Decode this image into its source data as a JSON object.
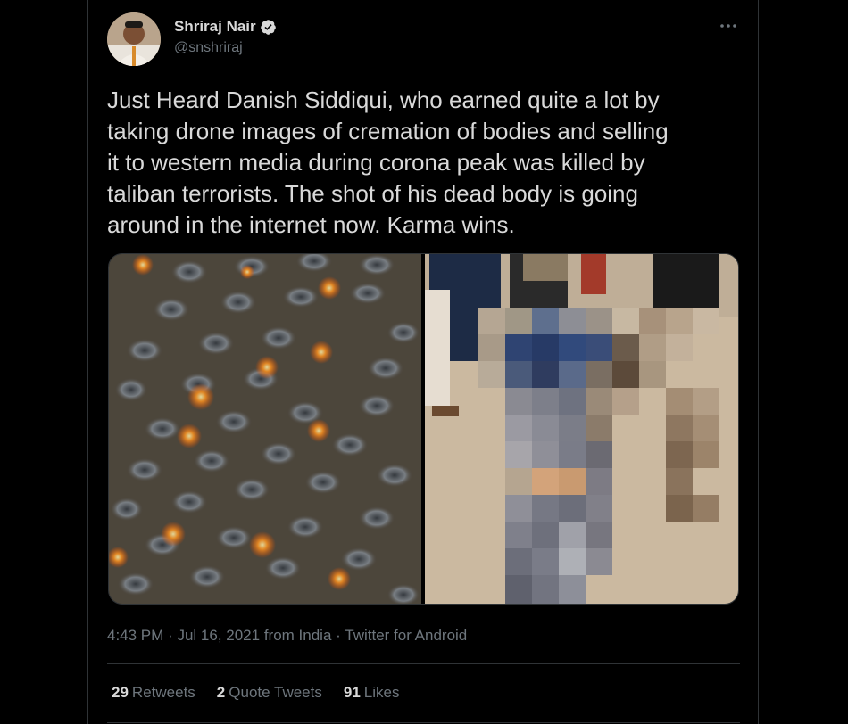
{
  "author": {
    "display_name": "Shriraj Nair",
    "handle": "@snshriraj",
    "verified": true
  },
  "tweet": {
    "text": "Just Heard Danish Siddiqui, who earned quite a lot by\ntaking drone images of cremation of bodies and selling\nit to western media during corona peak was killed by\ntaliban terrorists. The shot of his dead body is going\naround in the internet now. Karma wins."
  },
  "meta": {
    "time": "4:43 PM",
    "sep1": "·",
    "date": "Jul 16, 2021",
    "location": "from India",
    "sep2": "·",
    "source": "Twitter for Android"
  },
  "stats": {
    "retweets_count": "29",
    "retweets_label": "Retweets",
    "quote_count": "2",
    "quote_label": "Quote Tweets",
    "likes_count": "91",
    "likes_label": "Likes"
  },
  "icons": {
    "verified": "verified-badge-icon",
    "more": "more-options-icon"
  },
  "colors": {
    "background": "#000000",
    "text": "#d9d9d9",
    "secondary": "#6e767d",
    "border": "#2f3336",
    "verified": "#d9d9d9"
  }
}
